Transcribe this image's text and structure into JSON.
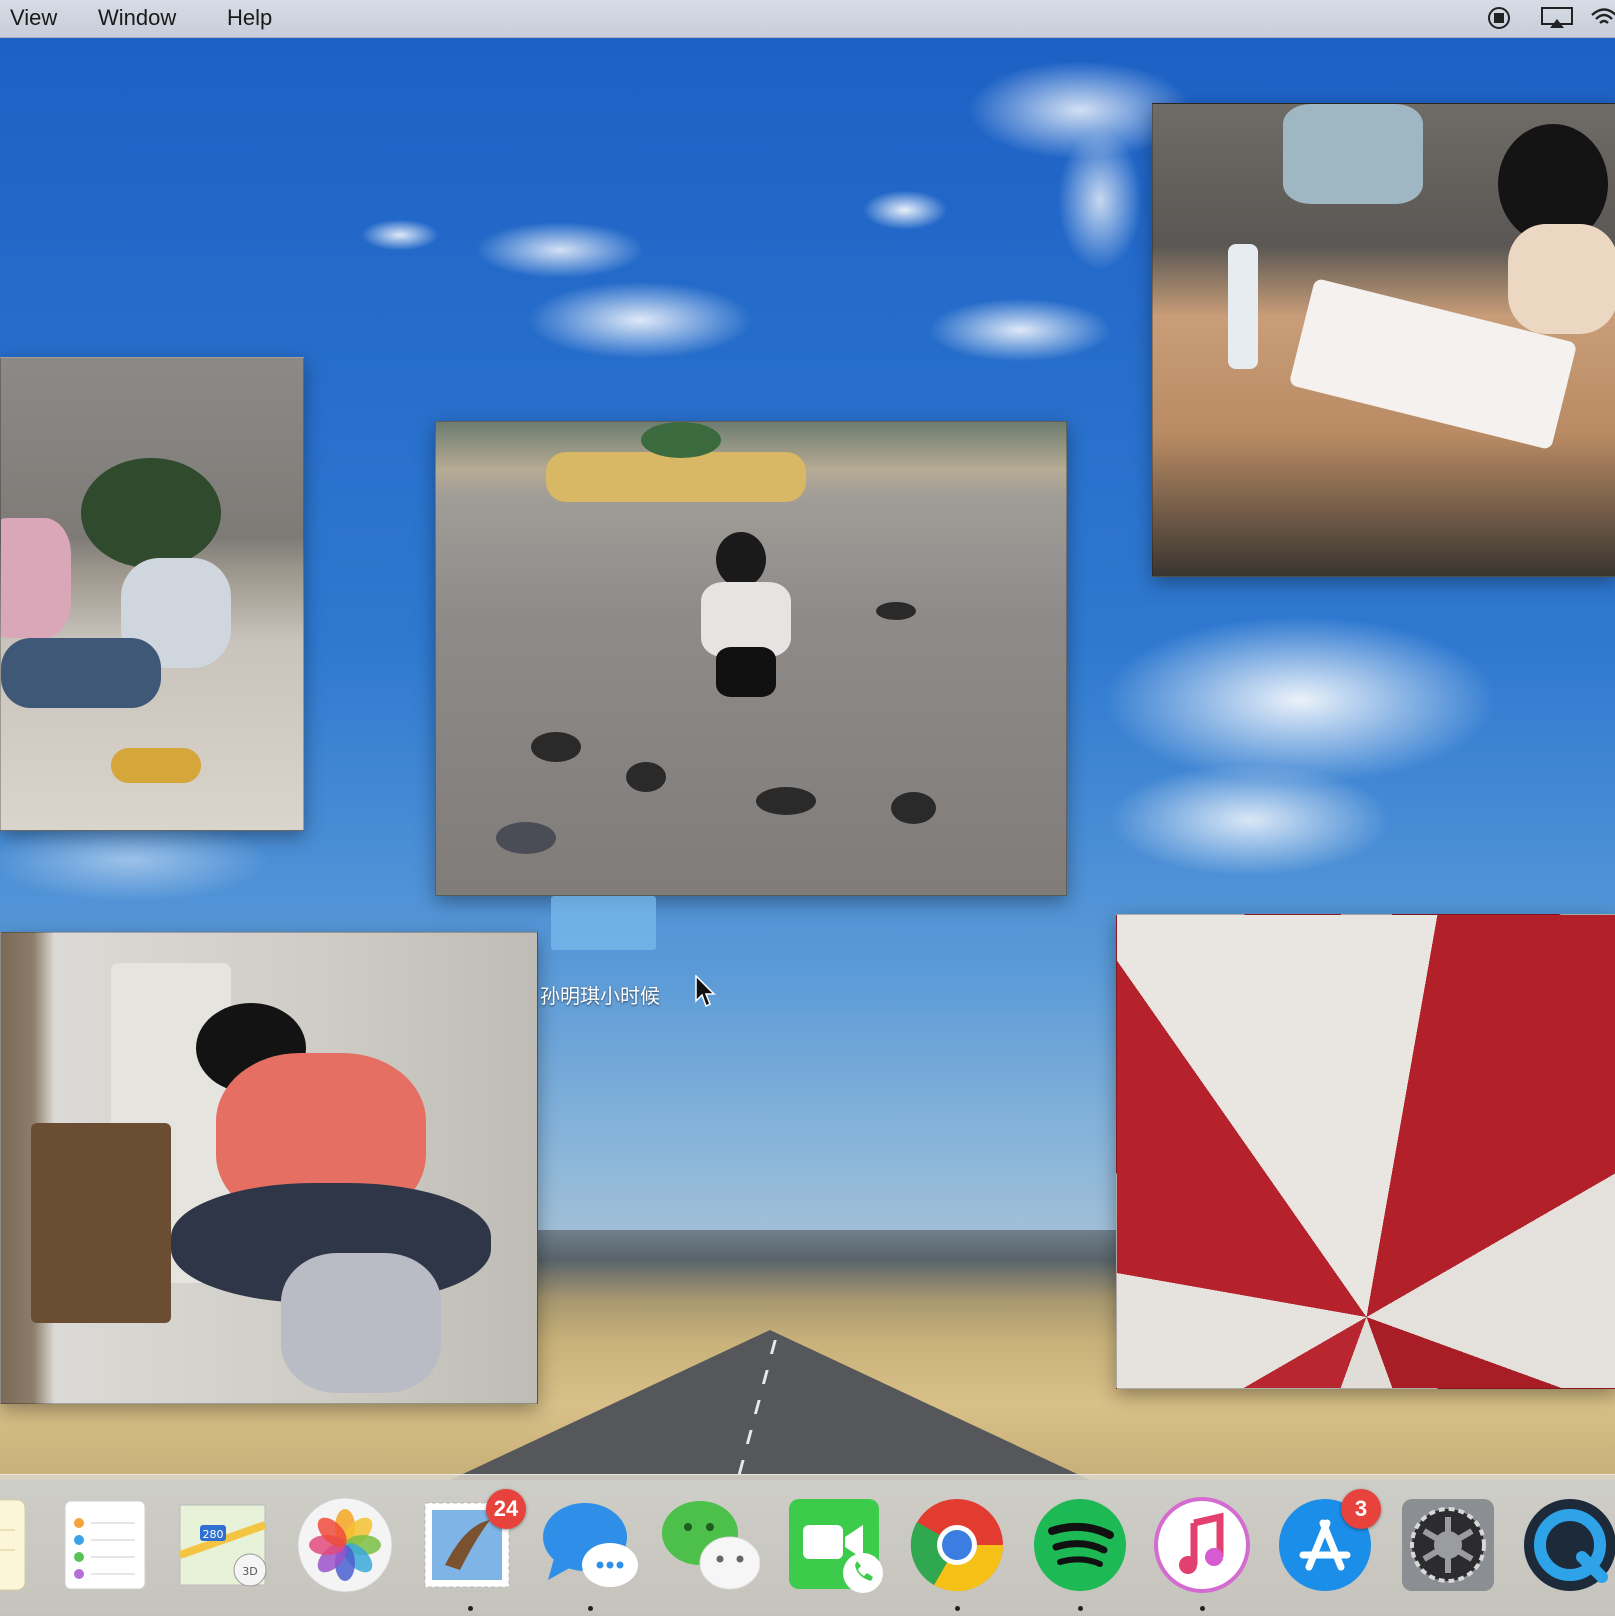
{
  "menubar": {
    "items": [
      "View",
      "Window",
      "Help"
    ],
    "status_icons": [
      "screen-record-icon",
      "airplay-icon",
      "wifi-icon"
    ]
  },
  "desktop": {
    "selected_file_label": "孙明琪小时候"
  },
  "dock": {
    "apps": [
      {
        "name": "notes-icon"
      },
      {
        "name": "reminders-icon"
      },
      {
        "name": "maps-icon",
        "detail": "280"
      },
      {
        "name": "photos-icon"
      },
      {
        "name": "mail-icon",
        "badge": "24"
      },
      {
        "name": "messages-icon"
      },
      {
        "name": "wechat-icon"
      },
      {
        "name": "facetime-icon"
      },
      {
        "name": "chrome-icon"
      },
      {
        "name": "spotify-icon"
      },
      {
        "name": "itunes-icon"
      },
      {
        "name": "app-store-icon",
        "badge": "3"
      },
      {
        "name": "system-preferences-icon"
      },
      {
        "name": "quicktime-icon"
      }
    ]
  },
  "colors": {
    "badge": "#e8423c",
    "selection": "#78b9eb"
  }
}
